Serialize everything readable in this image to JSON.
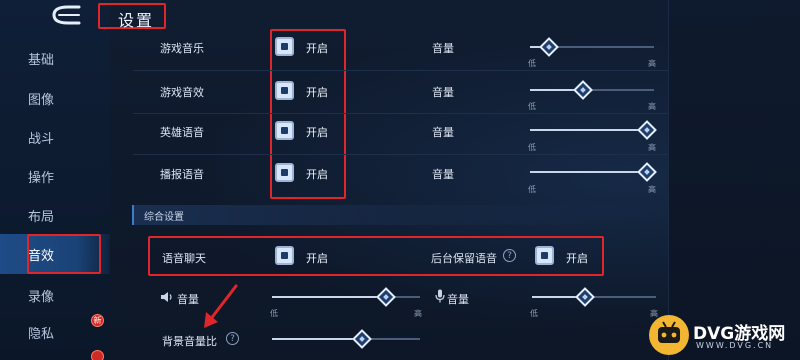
{
  "header": {
    "title": "设置"
  },
  "sidebar": {
    "items": [
      {
        "label": "基础"
      },
      {
        "label": "图像"
      },
      {
        "label": "战斗"
      },
      {
        "label": "操作"
      },
      {
        "label": "布局"
      },
      {
        "label": "音效"
      },
      {
        "label": "录像"
      },
      {
        "label": "隐私"
      }
    ],
    "active": "音效",
    "badge": "新"
  },
  "audio_rows": [
    {
      "label": "游戏音乐",
      "toggle": "开启",
      "checked": true,
      "volume_label": "音量",
      "volume": 0.11
    },
    {
      "label": "游戏音效",
      "toggle": "开启",
      "checked": true,
      "volume_label": "音量",
      "volume": 0.42
    },
    {
      "label": "英雄语音",
      "toggle": "开启",
      "checked": true,
      "volume_label": "音量",
      "volume": 1.0
    },
    {
      "label": "播报语音",
      "toggle": "开启",
      "checked": true,
      "volume_label": "音量",
      "volume": 1.0
    }
  ],
  "slider_labels": {
    "low": "低",
    "high": "高"
  },
  "general": {
    "header": "综合设置",
    "voice_chat": {
      "label": "语音聊天",
      "toggle": "开启",
      "checked": true
    },
    "background_voice": {
      "label": "后台保留语音",
      "toggle": "开启",
      "checked": true
    },
    "speaker_volume": {
      "label": "音量",
      "volume": 0.8,
      "icon": "speaker-icon"
    },
    "mic_volume": {
      "label": "音量",
      "volume": 0.42,
      "icon": "microphone-icon"
    },
    "bg_volume_ratio": {
      "label": "背景音量比",
      "volume": 0.62
    }
  },
  "watermark": {
    "brand": "DVG游戏网",
    "url": "WWW.DVG.CN"
  },
  "colors": {
    "highlight": "#e0262a",
    "active_tab": "#1f4b86"
  }
}
